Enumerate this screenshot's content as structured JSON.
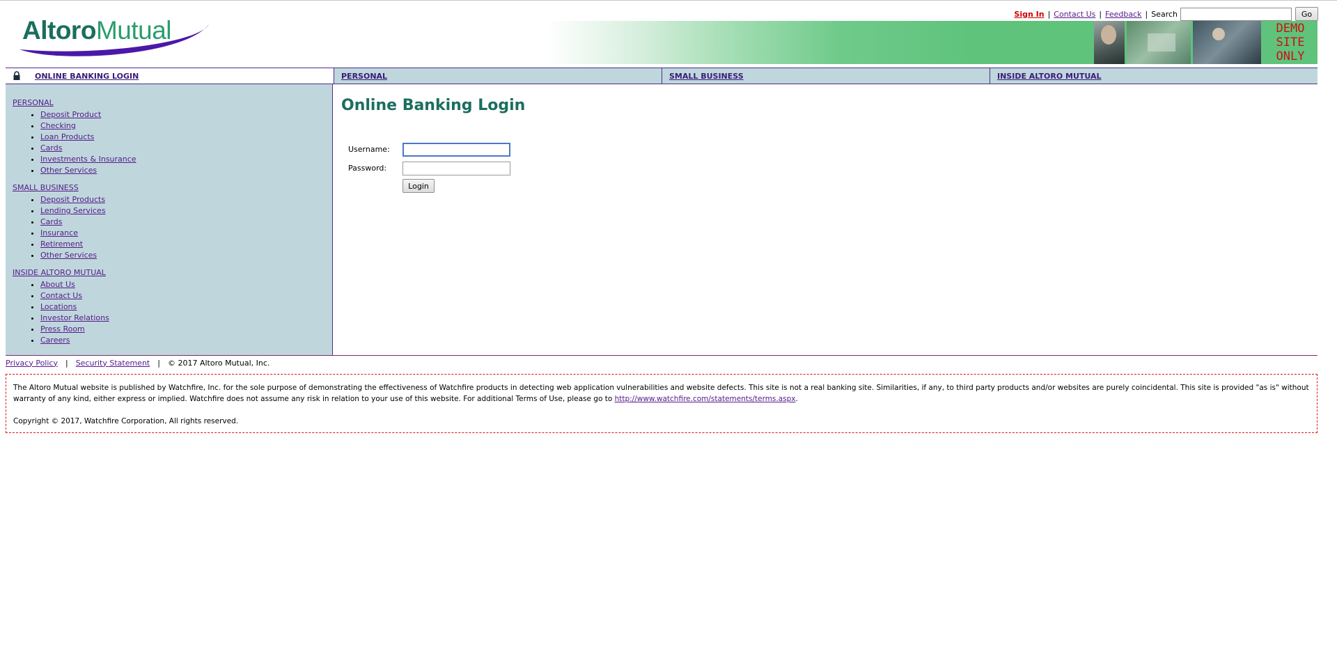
{
  "header": {
    "logo_primary": "Altoro",
    "logo_secondary": "Mutual",
    "links": {
      "sign_in": "Sign In",
      "contact_us": "Contact Us",
      "feedback": "Feedback",
      "search_label": "Search",
      "go": "Go"
    },
    "banner_text": [
      "DEMO",
      "SITE",
      "ONLY"
    ]
  },
  "tabs": [
    {
      "label": "ONLINE BANKING LOGIN"
    },
    {
      "label": "PERSONAL"
    },
    {
      "label": "SMALL BUSINESS"
    },
    {
      "label": "INSIDE ALTORO MUTUAL"
    }
  ],
  "sidebar": {
    "sections": [
      {
        "title": "PERSONAL",
        "items": [
          "Deposit Product",
          "Checking",
          "Loan Products",
          "Cards",
          "Investments & Insurance",
          "Other Services"
        ]
      },
      {
        "title": "SMALL BUSINESS",
        "items": [
          "Deposit Products",
          "Lending Services",
          "Cards",
          "Insurance",
          "Retirement",
          "Other Services"
        ]
      },
      {
        "title": "INSIDE ALTORO MUTUAL",
        "items": [
          "About Us",
          "Contact Us",
          "Locations",
          "Investor Relations",
          "Press Room",
          "Careers"
        ]
      }
    ]
  },
  "main": {
    "title": "Online Banking Login",
    "username_label": "Username:",
    "password_label": "Password:",
    "username_value": "",
    "password_value": "",
    "login_button": "Login"
  },
  "footer": {
    "privacy": "Privacy Policy",
    "security": "Security Statement",
    "copyright_short": "© 2017 Altoro Mutual, Inc.",
    "disclaimer_text": "The Altoro Mutual website is published by Watchfire, Inc. for the sole purpose of demonstrating the effectiveness of Watchfire products in detecting web application vulnerabilities and website defects. This site is not a real banking site. Similarities, if any, to third party products and/or websites are purely coincidental. This site is provided \"as is\" without warranty of any kind, either express or implied. Watchfire does not assume any risk in relation to your use of this website. For additional Terms of Use, please go to ",
    "terms_link": "http://www.watchfire.com/statements/terms.aspx",
    "terms_end": ".",
    "copyright_full": "Copyright © 2017, Watchfire Corporation, All rights reserved."
  },
  "colors": {
    "brand_green": "#1b6e5e",
    "nav_bg": "#bfd7dc",
    "border_purple": "#4b2d8f",
    "demo_red": "#cc1111"
  }
}
